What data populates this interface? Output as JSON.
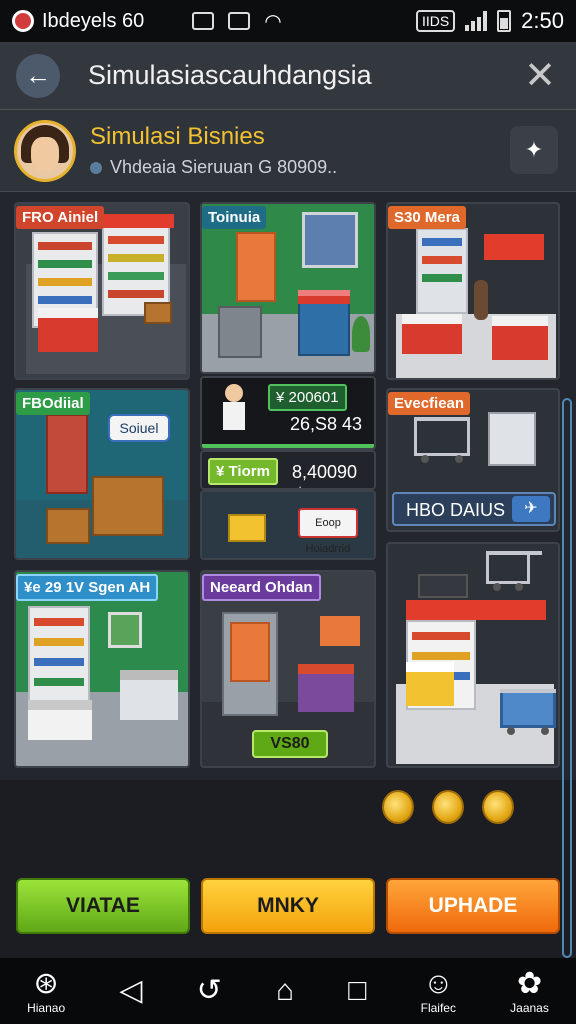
{
  "status_bar": {
    "app_name": "Ibdeyels 60",
    "badge": "IIDS",
    "time": "2:50"
  },
  "header": {
    "title": "Simulasiascauhdangsia",
    "back_icon": "arrow-left-icon",
    "close_icon": "close-icon"
  },
  "profile": {
    "title": "Simulasi Bisnies",
    "subtitle": "Vhdeaia Sieruuan G 80909.."
  },
  "tiles": {
    "t1": {
      "label": "FRO Ainiel"
    },
    "t2": {
      "label": "Toinuia"
    },
    "t3": {
      "label": "S30 Mera"
    },
    "t4": {
      "label": "FBOdiial",
      "bubble": "Soiuel"
    },
    "t5_row1": {
      "label": "¥ 200601",
      "value": "26,S8 43"
    },
    "t5_row2": {
      "label": "¥ Tiorm",
      "value": "8,40090 ★"
    },
    "t5_row3": {
      "sign": "Eoop Hoiadrrid"
    },
    "t6": {
      "label": "Evecfiean",
      "action": "HBO DAIUS"
    },
    "t7": {
      "label": "¥e 29 1V Sgen AH"
    },
    "t8": {
      "label": "Neeard Ohdan",
      "button": "VS80"
    },
    "t9": {}
  },
  "buttons": {
    "left": "VIATAE",
    "middle": "MNKY",
    "right": "UPHADE"
  },
  "nav": {
    "home": "Hianao",
    "friends": "Flaifec",
    "settings": "Jaanas"
  },
  "colors": {
    "accent_green": "#5fa816",
    "accent_yellow": "#f3a20c",
    "accent_orange": "#f06a0c",
    "title_gold": "#f2c230",
    "header_bg": "#33373e"
  }
}
